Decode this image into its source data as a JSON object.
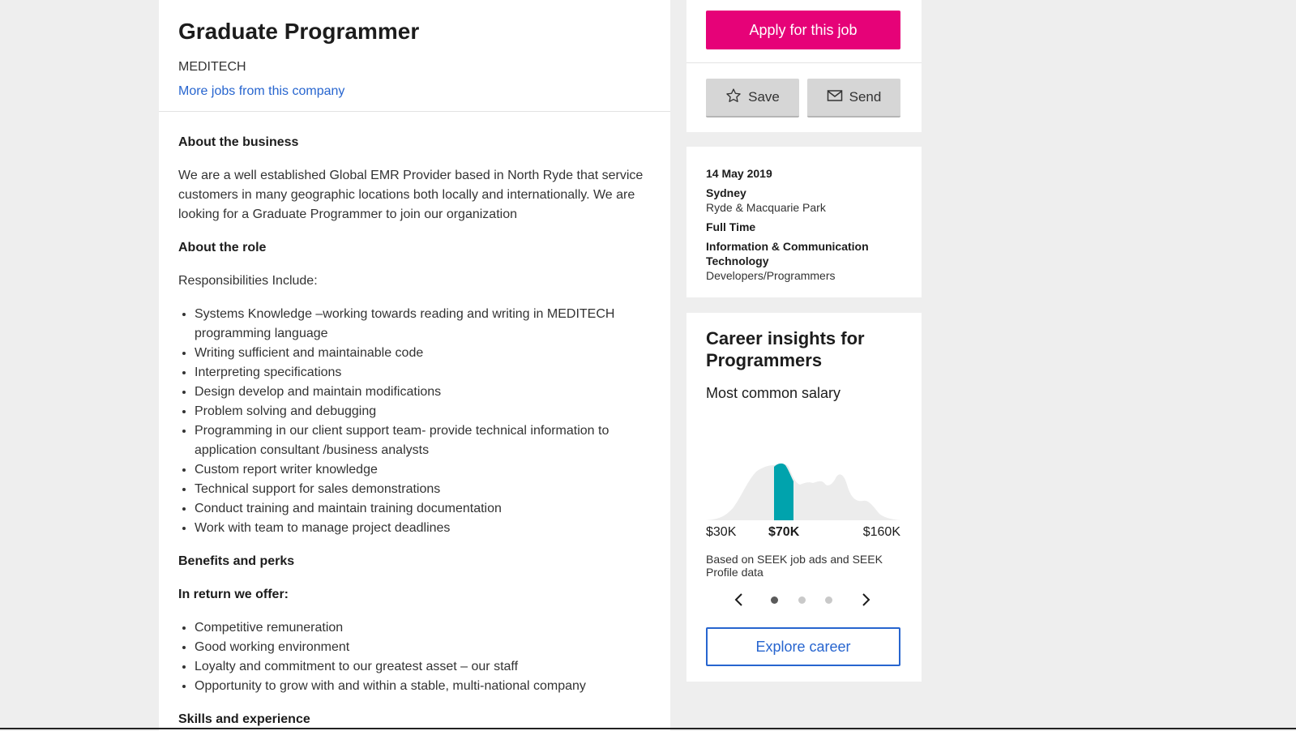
{
  "job": {
    "title": "Graduate Programmer",
    "company": "MEDITECH",
    "more_jobs_link": "More jobs from this company"
  },
  "description": {
    "about_business_heading": "About the business",
    "about_business_text": "We are a well established Global EMR Provider based in North Ryde that service customers in many geographic locations both locally and internationally. We are looking for a Graduate Programmer to join our organization",
    "about_role_heading": "About the role",
    "responsibilities_intro": "Responsibilities Include:",
    "responsibilities": [
      "Systems Knowledge –working towards reading and writing in  MEDITECH programming language",
      "Writing sufficient and maintainable code",
      "Interpreting  specifications",
      "Design develop and maintain modifications",
      "Problem solving and debugging",
      "Programming in our client support team- provide technical information to application consultant /business analysts",
      "Custom report writer knowledge",
      "Technical support for sales demonstrations",
      "Conduct training and maintain training documentation",
      "Work with team to manage project deadlines"
    ],
    "benefits_heading": "Benefits and perks",
    "offer_heading": "In return we offer:",
    "benefits": [
      "Competitive remuneration",
      "Good  working environment",
      "Loyalty and commitment to our greatest asset – our staff",
      "Opportunity to grow with and within a stable, multi-national company"
    ],
    "skills_heading": "Skills and experience"
  },
  "actions": {
    "apply_label": "Apply for this job",
    "save_label": "Save",
    "send_label": "Send"
  },
  "meta": {
    "date": "14 May 2019",
    "location": "Sydney",
    "area": "Ryde & Macquarie Park",
    "work_type": "Full Time",
    "classification": "Information & Communication Technology",
    "sub_classification": "Developers/Programmers"
  },
  "insights": {
    "title": "Career insights for Programmers",
    "subtitle": "Most common salary",
    "salary_min": "$30K",
    "salary_common": "$70K",
    "salary_max": "$160K",
    "based_on": "Based on SEEK job ads and SEEK Profile data",
    "carousel_active_index": 0,
    "carousel_count": 3,
    "explore_label": "Explore career",
    "accent_color": "#00a3ad"
  },
  "colors": {
    "apply_button": "#e60278",
    "link": "#2765cf",
    "histogram_fill": "#ececec",
    "highlight_fill": "#00a3ad"
  }
}
